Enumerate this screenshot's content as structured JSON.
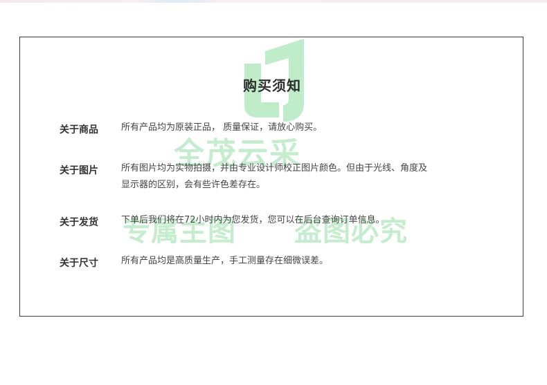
{
  "notice": {
    "title": "购买须知",
    "items": [
      {
        "label": "关于商品",
        "text": "所有产品均为原装正品， 质量保证，请放心购买。"
      },
      {
        "label": "关于图片",
        "text": "所有图片均为实物拍摄，并由专业设计师校正图片颜色。但由于光线、角度及显示器的区别，会有些许色差存在。"
      },
      {
        "label": "关于发货",
        "text": "下单后我们将在72小时内为您发货，您可以在后台查询订单信息。"
      },
      {
        "label": "关于尺寸",
        "text": "所有产品均是高质量生产，手工测量存在细微误差。"
      }
    ]
  },
  "watermark": {
    "brand": "全茂云采",
    "line1": "专属主图",
    "line2": "盗图必究",
    "color": "#2fc24e"
  },
  "colors": {
    "border": "#3a3a3a",
    "title": "#2d2d2d",
    "label": "#333333",
    "text": "#444444"
  }
}
